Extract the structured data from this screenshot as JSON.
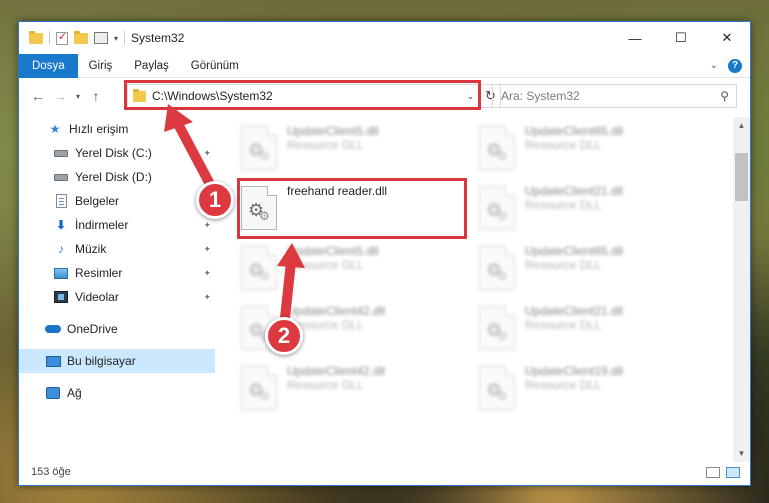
{
  "window": {
    "title": "System32"
  },
  "ribbon": {
    "tabs": [
      "Dosya",
      "Giriş",
      "Paylaş",
      "Görünüm"
    ]
  },
  "nav": {
    "address": "C:\\Windows\\System32",
    "search_placeholder": "Ara: System32"
  },
  "sidebar": {
    "items": [
      {
        "label": "Hızlı erişim",
        "icon": "star-icon"
      },
      {
        "label": "Yerel Disk (C:)",
        "icon": "drive-icon"
      },
      {
        "label": "Yerel Disk (D:)",
        "icon": "drive-icon"
      },
      {
        "label": "Belgeler",
        "icon": "document-icon"
      },
      {
        "label": "İndirmeler",
        "icon": "download-icon"
      },
      {
        "label": "Müzik",
        "icon": "music-icon"
      },
      {
        "label": "Resimler",
        "icon": "pictures-icon"
      },
      {
        "label": "Videolar",
        "icon": "videos-icon"
      },
      {
        "label": "OneDrive",
        "icon": "cloud-icon"
      },
      {
        "label": "Bu bilgisayar",
        "icon": "pc-icon"
      },
      {
        "label": "Ağ",
        "icon": "network-icon"
      }
    ]
  },
  "files": {
    "highlighted": {
      "name": "freehand reader.dll"
    },
    "blurred": [
      {
        "name": "UpdateClient5.dll",
        "type": "Resource DLL"
      },
      {
        "name": "UpdateClient65.dll",
        "type": "Resource DLL"
      },
      {
        "name": "UpdateClient21.dll",
        "type": "Resource DLL"
      },
      {
        "name": "UpdateClient5.dll",
        "type": "Resource DLL"
      },
      {
        "name": "UpdateClient65.dll",
        "type": "Resource DLL"
      },
      {
        "name": "UpdateClient42.dll",
        "type": "Resource DLL"
      },
      {
        "name": "UpdateClient21.dll",
        "type": "Resource DLL"
      },
      {
        "name": "UpdateClient42.dll",
        "type": "Resource DLL"
      },
      {
        "name": "UpdateClient19.dll",
        "type": "Resource DLL"
      }
    ]
  },
  "status": {
    "count": "153 öğe"
  },
  "annotations": {
    "badge1": "1",
    "badge2": "2"
  },
  "colors": {
    "accent": "#1979ca",
    "highlight": "#d9363e",
    "badge": "#dc3a40",
    "selection": "#cce8ff"
  }
}
